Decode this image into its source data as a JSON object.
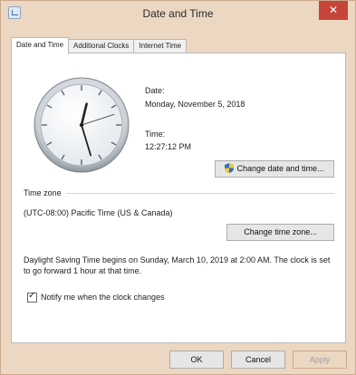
{
  "window": {
    "title": "Date and Time",
    "close_glyph": "✕"
  },
  "tabs": [
    {
      "label": "Date and Time",
      "active": true
    },
    {
      "label": "Additional Clocks",
      "active": false
    },
    {
      "label": "Internet Time",
      "active": false
    }
  ],
  "date": {
    "label": "Date:",
    "value": "Monday, November 5, 2018"
  },
  "time": {
    "label": "Time:",
    "value": "12:27:12 PM"
  },
  "clock": {
    "hours": 12,
    "minutes": 27,
    "seconds": 12
  },
  "change_datetime_label": "Change date and time...",
  "timezone": {
    "heading": "Time zone",
    "value": "(UTC-08:00) Pacific Time (US & Canada)",
    "change_label": "Change time zone..."
  },
  "dst_text": "Daylight Saving Time begins on Sunday, March 10, 2019 at 2:00 AM. The clock is set to go forward 1 hour at that time.",
  "notify": {
    "label": "Notify me when the clock changes",
    "checked": true
  },
  "footer": {
    "ok_label": "OK",
    "cancel_label": "Cancel",
    "apply_label": "Apply"
  },
  "colors": {
    "frame": "#ecd7c2",
    "close_button": "#c7443a",
    "shield_blue": "#2f6fb8",
    "shield_yellow": "#f2c53d"
  }
}
